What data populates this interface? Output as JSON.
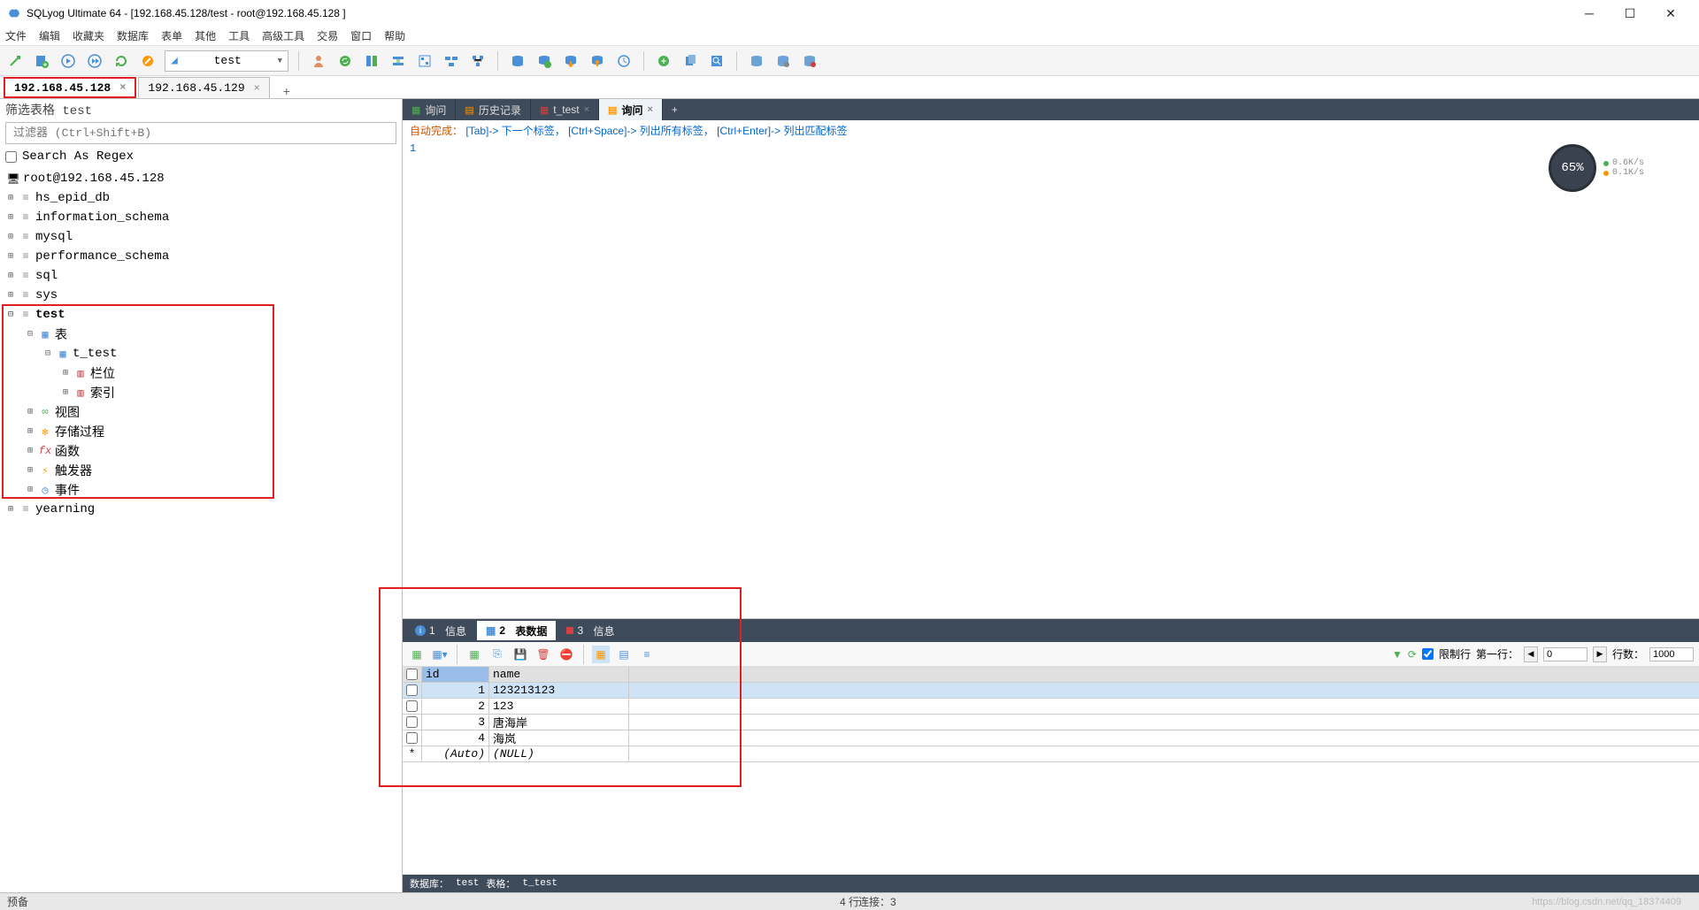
{
  "title": "SQLyog Ultimate 64 - [192.168.45.128/test - root@192.168.45.128 ]",
  "menu": [
    "文件",
    "编辑",
    "收藏夹",
    "数据库",
    "表单",
    "其他",
    "工具",
    "高级工具",
    "交易",
    "窗口",
    "帮助"
  ],
  "db_combo": "test",
  "conn_tabs": [
    {
      "label": "192.168.45.128",
      "active": true
    },
    {
      "label": "192.168.45.129",
      "active": false
    }
  ],
  "sidebar": {
    "filter_label": "筛选表格 test",
    "filter_placeholder": "过滤器 (Ctrl+Shift+B)",
    "regex_label": "Search As Regex",
    "root": "root@192.168.45.128",
    "dbs": [
      "hs_epid_db",
      "information_schema",
      "mysql",
      "performance_schema",
      "sql",
      "sys"
    ],
    "test_db": "test",
    "test_nodes": {
      "tables": "表",
      "table_name": "t_test",
      "columns": "栏位",
      "indexes": "索引",
      "views": "视图",
      "procs": "存储过程",
      "funcs": "函数",
      "triggers": "触发器",
      "events": "事件"
    },
    "last_db": "yearning"
  },
  "editor_tabs": [
    {
      "icon": "query",
      "label": "询问"
    },
    {
      "icon": "history",
      "label": "历史记录"
    },
    {
      "icon": "table",
      "label": "t_test"
    },
    {
      "icon": "query",
      "label": "询问",
      "active": true
    }
  ],
  "hint": {
    "prefix": "自动完成：",
    "parts": [
      "[Tab]-> 下一个标签，",
      "[Ctrl+Space]-> 列出所有标签，",
      "[Ctrl+Enter]-> 列出匹配标签"
    ]
  },
  "editor_text": "1",
  "gauge": {
    "pct": "65%",
    "up": "0.6K/s",
    "down": "0.1K/s"
  },
  "result_tabs": [
    {
      "num": "1",
      "label": "信息"
    },
    {
      "num": "2",
      "label": "表数据",
      "active": true
    },
    {
      "num": "3",
      "label": "信息"
    }
  ],
  "grid": {
    "headers": [
      "id",
      "name"
    ],
    "rows": [
      {
        "id": "1",
        "name": "123213123",
        "selected": true
      },
      {
        "id": "2",
        "name": "123"
      },
      {
        "id": "3",
        "name": "唐海岸"
      },
      {
        "id": "4",
        "name": "海岚"
      }
    ],
    "new_row": {
      "id": "(Auto)",
      "name": "(NULL)"
    }
  },
  "limit": {
    "chk_label": "限制行",
    "first_label": "第一行：",
    "first_val": "0",
    "rows_label": "行数：",
    "rows_val": "1000"
  },
  "result_status": {
    "db_label": "数据库：",
    "db": "test",
    "tbl_label": "表格：",
    "tbl": "t_test"
  },
  "statusbar": {
    "left": "预备",
    "rows": "4 行",
    "conn": "连接：3"
  },
  "watermark": "https://blog.csdn.net/qq_18374409"
}
